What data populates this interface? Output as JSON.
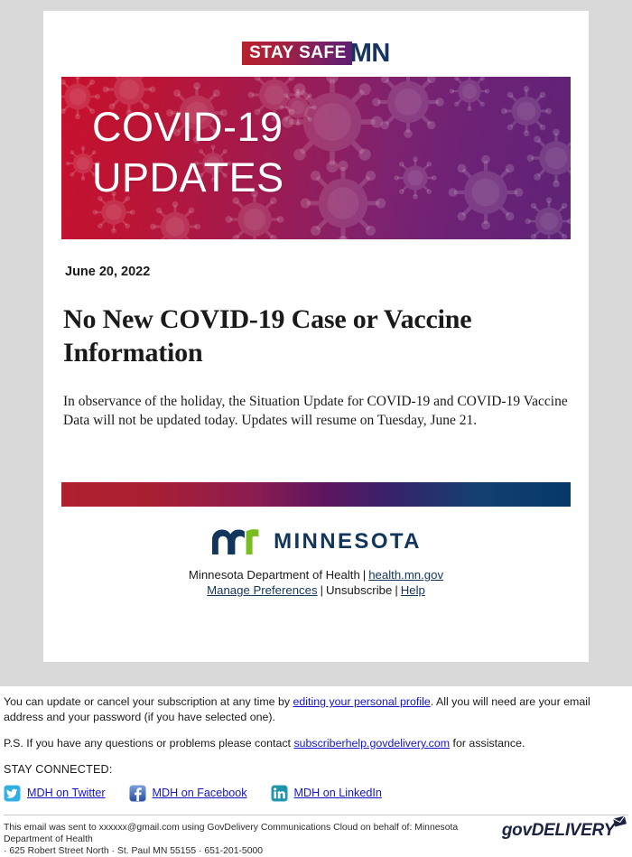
{
  "brand": {
    "staysafe_text": "STAY SAFE",
    "staysafe_mn": "MN"
  },
  "hero": {
    "line1": "COVID-19",
    "line2": "UPDATES"
  },
  "email": {
    "issue_date": "June 20, 2022",
    "headline": "No New COVID-19 Case or Vaccine Information",
    "body": "In observance of the holiday, the Situation Update for COVID-19 and COVID-19 Vaccine Data will not be updated today. Updates will resume on Tuesday, June 21."
  },
  "mn_footer": {
    "wordmark": "MINNESOTA",
    "agency": "Minnesota Department of Health",
    "website": "health.mn.gov",
    "manage_preferences": "Manage Preferences",
    "unsubscribe": "Unsubscribe",
    "help": "Help",
    "separator": "|"
  },
  "govdelivery": {
    "para1_before": "You can update or cancel your subscription at any time by ",
    "para1_link": "editing your personal profile",
    "para1_after": ". All you will need are your email address and your password (if you have selected one).",
    "para2_before": "P.S. If you have any questions or problems please contact ",
    "para2_link": "subscriberhelp.govdelivery.com",
    "para2_after": " for assistance.",
    "stay_connected": "STAY CONNECTED:",
    "social": [
      {
        "label": "MDH on Twitter",
        "icon": "twitter-icon"
      },
      {
        "label": "MDH on Facebook",
        "icon": "facebook-icon"
      },
      {
        "label": "MDH on LinkedIn",
        "icon": "linkedin-icon"
      }
    ],
    "legal_line1": "This email was sent to xxxxxx@gmail.com using GovDelivery Communications Cloud on behalf of: Minnesota Department of Health",
    "legal_line2": "· 625 Robert Street North · St. Paul MN 55155 · 651-201-5000",
    "brand_lower": "gov",
    "brand_upper": "DELIVERY"
  },
  "colors": {
    "page_background": "#d9d9d9",
    "card_background": "#ffffff",
    "mn_navy": "#12355b",
    "mn_green": "#78be21",
    "hero_red": "#c8102e",
    "hero_purple": "#5f2375",
    "link_blue": "#1414cc"
  }
}
